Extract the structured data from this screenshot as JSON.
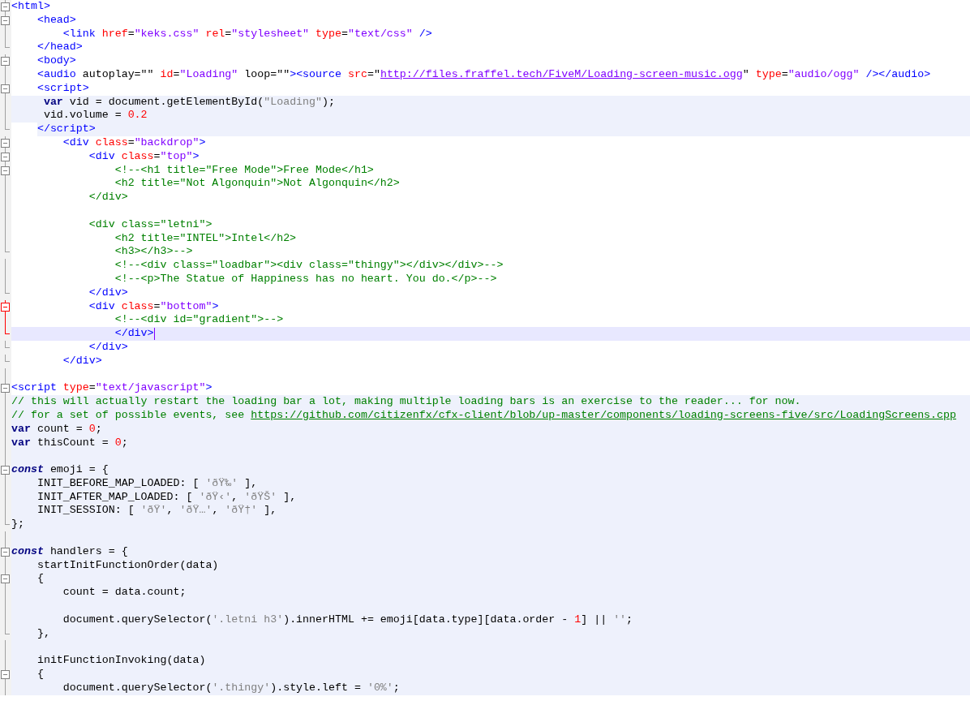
{
  "editor": {
    "lines": [
      {
        "open": true,
        "end": false,
        "active": false,
        "script": false,
        "current": false,
        "tokens": [
          {
            "kind": "tag",
            "text": "<html>"
          }
        ]
      },
      {
        "open": true,
        "end": false,
        "active": false,
        "script": false,
        "current": false,
        "tokens": [
          {
            "kind": "tag",
            "text": "    <head>"
          }
        ]
      },
      {
        "open": false,
        "end": false,
        "active": false,
        "script": false,
        "current": false,
        "tokens": [
          {
            "kind": "tag",
            "text": "        <link "
          },
          {
            "kind": "attr",
            "text": "href"
          },
          {
            "kind": "plain",
            "text": "="
          },
          {
            "kind": "value",
            "text": "\"keks.css\" "
          },
          {
            "kind": "attr",
            "text": "rel"
          },
          {
            "kind": "plain",
            "text": "="
          },
          {
            "kind": "value",
            "text": "\"stylesheet\" "
          },
          {
            "kind": "attr",
            "text": "type"
          },
          {
            "kind": "plain",
            "text": "="
          },
          {
            "kind": "value",
            "text": "\"text/css\" "
          },
          {
            "kind": "tag",
            "text": "/>"
          }
        ]
      },
      {
        "open": false,
        "end": true,
        "active": false,
        "script": false,
        "current": false,
        "tokens": [
          {
            "kind": "tag",
            "text": "    </head>"
          }
        ]
      },
      {
        "open": true,
        "end": false,
        "active": false,
        "script": false,
        "current": false,
        "tokens": [
          {
            "kind": "tag",
            "text": "    <body>"
          }
        ]
      },
      {
        "open": false,
        "end": false,
        "active": false,
        "script": false,
        "current": false,
        "tokens": [
          {
            "kind": "tag",
            "text": "    <audio "
          },
          {
            "kind": "plain",
            "text": "autoplay=\"\" "
          },
          {
            "kind": "attr",
            "text": "id"
          },
          {
            "kind": "plain",
            "text": "="
          },
          {
            "kind": "value",
            "text": "\"Loading\" "
          },
          {
            "kind": "plain",
            "text": "loop=\"\""
          },
          {
            "kind": "tag",
            "text": "><source "
          },
          {
            "kind": "attr",
            "text": "src"
          },
          {
            "kind": "plain",
            "text": "=\""
          },
          {
            "kind": "link",
            "text": "http://files.fraffel.tech/FiveM/Loading-screen-music.ogg"
          },
          {
            "kind": "plain",
            "text": "\" "
          },
          {
            "kind": "attr",
            "text": "type"
          },
          {
            "kind": "plain",
            "text": "="
          },
          {
            "kind": "value",
            "text": "\"audio/ogg\" "
          },
          {
            "kind": "tag",
            "text": "/></audio>"
          }
        ]
      },
      {
        "open": true,
        "end": false,
        "active": false,
        "script": false,
        "current": false,
        "tokens": [
          {
            "kind": "tag",
            "text": "    <script>"
          }
        ]
      },
      {
        "open": false,
        "end": false,
        "active": false,
        "script": true,
        "current": false,
        "tokens": [
          {
            "kind": "keyword",
            "text": "     var"
          },
          {
            "kind": "plain",
            "text": " vid = document.getElementById("
          },
          {
            "kind": "jstring",
            "text": "\"Loading\""
          },
          {
            "kind": "plain",
            "text": ");"
          }
        ]
      },
      {
        "open": false,
        "end": false,
        "active": false,
        "script": true,
        "current": false,
        "tokens": [
          {
            "kind": "plain",
            "text": "     vid.volume = "
          },
          {
            "kind": "number",
            "text": "0.2"
          }
        ]
      },
      {
        "open": false,
        "end": true,
        "active": false,
        "script": true,
        "current": false,
        "tokens": [
          {
            "kind": "tag",
            "text": "    </script>"
          }
        ]
      },
      {
        "open": true,
        "end": false,
        "active": false,
        "script": false,
        "current": false,
        "tokens": [
          {
            "kind": "tag",
            "text": "        <div "
          },
          {
            "kind": "attr",
            "text": "class"
          },
          {
            "kind": "plain",
            "text": "="
          },
          {
            "kind": "value",
            "text": "\"backdrop\""
          },
          {
            "kind": "tag",
            "text": ">"
          }
        ]
      },
      {
        "open": true,
        "end": false,
        "active": false,
        "script": false,
        "current": false,
        "tokens": [
          {
            "kind": "tag",
            "text": "            <div "
          },
          {
            "kind": "attr",
            "text": "class"
          },
          {
            "kind": "plain",
            "text": "="
          },
          {
            "kind": "value",
            "text": "\"top\""
          },
          {
            "kind": "tag",
            "text": ">"
          }
        ]
      },
      {
        "open": true,
        "end": false,
        "active": false,
        "script": false,
        "current": false,
        "tokens": [
          {
            "kind": "comment",
            "text": "                <!--<h1 title=\"Free Mode\">Free Mode</h1>"
          }
        ]
      },
      {
        "open": false,
        "end": false,
        "active": false,
        "script": false,
        "current": false,
        "tokens": [
          {
            "kind": "comment",
            "text": "                <h2 title=\"Not Algonquin\">Not Algonquin</h2>"
          }
        ]
      },
      {
        "open": false,
        "end": false,
        "active": false,
        "script": false,
        "current": false,
        "tokens": [
          {
            "kind": "comment",
            "text": "            </div>"
          }
        ]
      },
      {
        "open": false,
        "end": false,
        "active": false,
        "script": false,
        "current": false
      },
      {
        "open": false,
        "end": false,
        "active": false,
        "script": false,
        "current": false,
        "tokens": [
          {
            "kind": "comment",
            "text": "            <div class=\"letni\">"
          }
        ]
      },
      {
        "open": false,
        "end": false,
        "active": false,
        "script": false,
        "current": false,
        "tokens": [
          {
            "kind": "comment",
            "text": "                <h2 title=\"INTEL\">Intel</h2>"
          }
        ]
      },
      {
        "open": false,
        "end": true,
        "active": false,
        "script": false,
        "current": false,
        "tokens": [
          {
            "kind": "comment",
            "text": "                <h3></h3>-->"
          }
        ]
      },
      {
        "open": false,
        "end": false,
        "active": false,
        "script": false,
        "current": false,
        "tokens": [
          {
            "kind": "comment",
            "text": "                <!--<div class=\"loadbar\"><div class=\"thingy\"></div></div>-->"
          }
        ]
      },
      {
        "open": false,
        "end": false,
        "active": false,
        "script": false,
        "current": false,
        "tokens": [
          {
            "kind": "comment",
            "text": "                <!--<p>The Statue of Happiness has no heart. You do.</p>-->"
          }
        ]
      },
      {
        "open": false,
        "end": true,
        "active": false,
        "script": false,
        "current": false,
        "tokens": [
          {
            "kind": "tag",
            "text": "            </div>"
          }
        ]
      },
      {
        "open": true,
        "end": false,
        "active": true,
        "script": false,
        "current": false,
        "tokens": [
          {
            "kind": "tag",
            "text": "            <div "
          },
          {
            "kind": "attr",
            "text": "class"
          },
          {
            "kind": "plain",
            "text": "="
          },
          {
            "kind": "value",
            "text": "\"bottom\""
          },
          {
            "kind": "tag",
            "text": ">"
          }
        ]
      },
      {
        "open": false,
        "end": false,
        "active": true,
        "script": false,
        "current": false,
        "tokens": [
          {
            "kind": "comment",
            "text": "                <!--<div id=\"gradient\">-->"
          }
        ]
      },
      {
        "open": false,
        "end": true,
        "active": true,
        "script": false,
        "current": true,
        "tokens": [
          {
            "kind": "tag",
            "text": "                </div>"
          }
        ]
      },
      {
        "open": false,
        "end": true,
        "active": false,
        "script": false,
        "current": false,
        "tokens": [
          {
            "kind": "tag",
            "text": "            </div>"
          }
        ]
      },
      {
        "open": false,
        "end": true,
        "active": false,
        "script": false,
        "current": false,
        "tokens": [
          {
            "kind": "tag",
            "text": "        </div>"
          }
        ]
      },
      {
        "open": false,
        "end": false,
        "active": false,
        "script": false,
        "current": false
      },
      {
        "open": true,
        "end": false,
        "active": false,
        "script": false,
        "current": false,
        "tokens": [
          {
            "kind": "tag",
            "text": "<script "
          },
          {
            "kind": "attr",
            "text": "type"
          },
          {
            "kind": "plain",
            "text": "="
          },
          {
            "kind": "value",
            "text": "\"text/javascript\""
          },
          {
            "kind": "tag",
            "text": ">"
          }
        ]
      },
      {
        "open": false,
        "end": false,
        "active": false,
        "script": true,
        "current": false,
        "tokens": [
          {
            "kind": "comment",
            "text": "// this will actually restart the loading bar a lot, making multiple loading bars is an exercise to the reader... for now."
          }
        ]
      },
      {
        "open": false,
        "end": false,
        "active": false,
        "script": true,
        "current": false,
        "tokens": [
          {
            "kind": "comment",
            "text": "// for a set of possible events, see "
          },
          {
            "kind": "comment_link",
            "text": "https://github.com/citizenfx/cfx-client/blob/up-master/components/loading-screens-five/src/LoadingScreens.cpp"
          }
        ]
      },
      {
        "open": false,
        "end": false,
        "active": false,
        "script": true,
        "current": false,
        "tokens": [
          {
            "kind": "keyword",
            "text": "var"
          },
          {
            "kind": "plain",
            "text": " count = "
          },
          {
            "kind": "number",
            "text": "0"
          },
          {
            "kind": "plain",
            "text": ";"
          }
        ]
      },
      {
        "open": false,
        "end": false,
        "active": false,
        "script": true,
        "current": false,
        "tokens": [
          {
            "kind": "keyword",
            "text": "var"
          },
          {
            "kind": "plain",
            "text": " thisCount = "
          },
          {
            "kind": "number",
            "text": "0"
          },
          {
            "kind": "plain",
            "text": ";"
          }
        ]
      },
      {
        "open": false,
        "end": false,
        "active": false,
        "script": true,
        "current": false
      },
      {
        "open": true,
        "end": false,
        "active": false,
        "script": true,
        "current": false,
        "tokens": [
          {
            "kind": "keyword_italic",
            "text": "const"
          },
          {
            "kind": "plain",
            "text": " emoji = {"
          }
        ]
      },
      {
        "open": false,
        "end": false,
        "active": false,
        "script": true,
        "current": false,
        "tokens": [
          {
            "kind": "plain",
            "text": "    INIT_BEFORE_MAP_LOADED: [ "
          },
          {
            "kind": "jstring",
            "text": "'ðŸ‰'"
          },
          {
            "kind": "plain",
            "text": " ],"
          }
        ]
      },
      {
        "open": false,
        "end": false,
        "active": false,
        "script": true,
        "current": false,
        "tokens": [
          {
            "kind": "plain",
            "text": "    INIT_AFTER_MAP_LOADED: [ "
          },
          {
            "kind": "jstring",
            "text": "'ðŸ‹'"
          },
          {
            "kind": "plain",
            "text": ", "
          },
          {
            "kind": "jstring",
            "text": "'ðŸŠ'"
          },
          {
            "kind": "plain",
            "text": " ],"
          }
        ]
      },
      {
        "open": false,
        "end": false,
        "active": false,
        "script": true,
        "current": false,
        "tokens": [
          {
            "kind": "plain",
            "text": "    INIT_SESSION: [ "
          },
          {
            "kind": "jstring",
            "text": "'ðŸ'"
          },
          {
            "kind": "plain",
            "text": ", "
          },
          {
            "kind": "jstring",
            "text": "'ðŸ…'"
          },
          {
            "kind": "plain",
            "text": ", "
          },
          {
            "kind": "jstring",
            "text": "'ðŸ†'"
          },
          {
            "kind": "plain",
            "text": " ],"
          }
        ]
      },
      {
        "open": false,
        "end": true,
        "active": false,
        "script": true,
        "current": false,
        "tokens": [
          {
            "kind": "plain",
            "text": "};"
          }
        ]
      },
      {
        "open": false,
        "end": false,
        "active": false,
        "script": true,
        "current": false
      },
      {
        "open": true,
        "end": false,
        "active": false,
        "script": true,
        "current": false,
        "tokens": [
          {
            "kind": "keyword_italic",
            "text": "const"
          },
          {
            "kind": "plain",
            "text": " handlers = {"
          }
        ]
      },
      {
        "open": false,
        "end": false,
        "active": false,
        "script": true,
        "current": false,
        "tokens": [
          {
            "kind": "plain",
            "text": "    startInitFunctionOrder(data)"
          }
        ]
      },
      {
        "open": true,
        "end": false,
        "active": false,
        "script": true,
        "current": false,
        "tokens": [
          {
            "kind": "plain",
            "text": "    {"
          }
        ]
      },
      {
        "open": false,
        "end": false,
        "active": false,
        "script": true,
        "current": false,
        "tokens": [
          {
            "kind": "plain",
            "text": "        count = data.count;"
          }
        ]
      },
      {
        "open": false,
        "end": false,
        "active": false,
        "script": true,
        "current": false
      },
      {
        "open": false,
        "end": false,
        "active": false,
        "script": true,
        "current": false,
        "tokens": [
          {
            "kind": "plain",
            "text": "        document.querySelector("
          },
          {
            "kind": "jstring",
            "text": "'.letni h3'"
          },
          {
            "kind": "plain",
            "text": ").innerHTML += emoji[data.type][data.order - "
          },
          {
            "kind": "number",
            "text": "1"
          },
          {
            "kind": "plain",
            "text": "] || "
          },
          {
            "kind": "jstring",
            "text": "''"
          },
          {
            "kind": "plain",
            "text": ";"
          }
        ]
      },
      {
        "open": false,
        "end": true,
        "active": false,
        "script": true,
        "current": false,
        "tokens": [
          {
            "kind": "plain",
            "text": "    },"
          }
        ]
      },
      {
        "open": false,
        "end": false,
        "active": false,
        "script": true,
        "current": false
      },
      {
        "open": false,
        "end": false,
        "active": false,
        "script": true,
        "current": false,
        "tokens": [
          {
            "kind": "plain",
            "text": "    initFunctionInvoking(data)"
          }
        ]
      },
      {
        "open": true,
        "end": false,
        "active": false,
        "script": true,
        "current": false,
        "tokens": [
          {
            "kind": "plain",
            "text": "    {"
          }
        ]
      },
      {
        "open": false,
        "end": false,
        "active": false,
        "script": true,
        "current": false,
        "tokens": [
          {
            "kind": "plain",
            "text": "        document.querySelector("
          },
          {
            "kind": "jstring",
            "text": "'.thingy'"
          },
          {
            "kind": "plain",
            "text": ").style.left = "
          },
          {
            "kind": "jstring",
            "text": "'0%'"
          },
          {
            "kind": "plain",
            "text": ";"
          }
        ]
      }
    ]
  }
}
